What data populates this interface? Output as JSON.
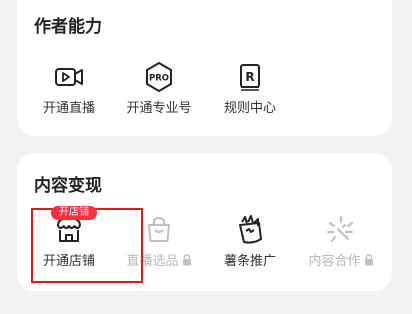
{
  "author_section": {
    "title": "作者能力",
    "items": [
      {
        "label": "开通直播",
        "icon": "live-video-icon"
      },
      {
        "label": "开通专业号",
        "icon": "pro-badge-icon"
      },
      {
        "label": "规则中心",
        "icon": "rules-icon"
      }
    ]
  },
  "monetize_section": {
    "title": "内容变现",
    "items": [
      {
        "label": "开通店铺",
        "icon": "shop-icon",
        "badge": "开店铺"
      },
      {
        "label": "直播选品",
        "icon": "shopping-bag-icon",
        "locked": true
      },
      {
        "label": "薯条推广",
        "icon": "fries-icon"
      },
      {
        "label": "内容合作",
        "icon": "sparkle-icon",
        "locked": true
      }
    ]
  },
  "colors": {
    "accent_red": "#ff2d3f",
    "highlight_border": "#e8141e",
    "text_primary": "#222222",
    "text_disabled": "#b9b9b9",
    "background": "#f2f2f4"
  }
}
